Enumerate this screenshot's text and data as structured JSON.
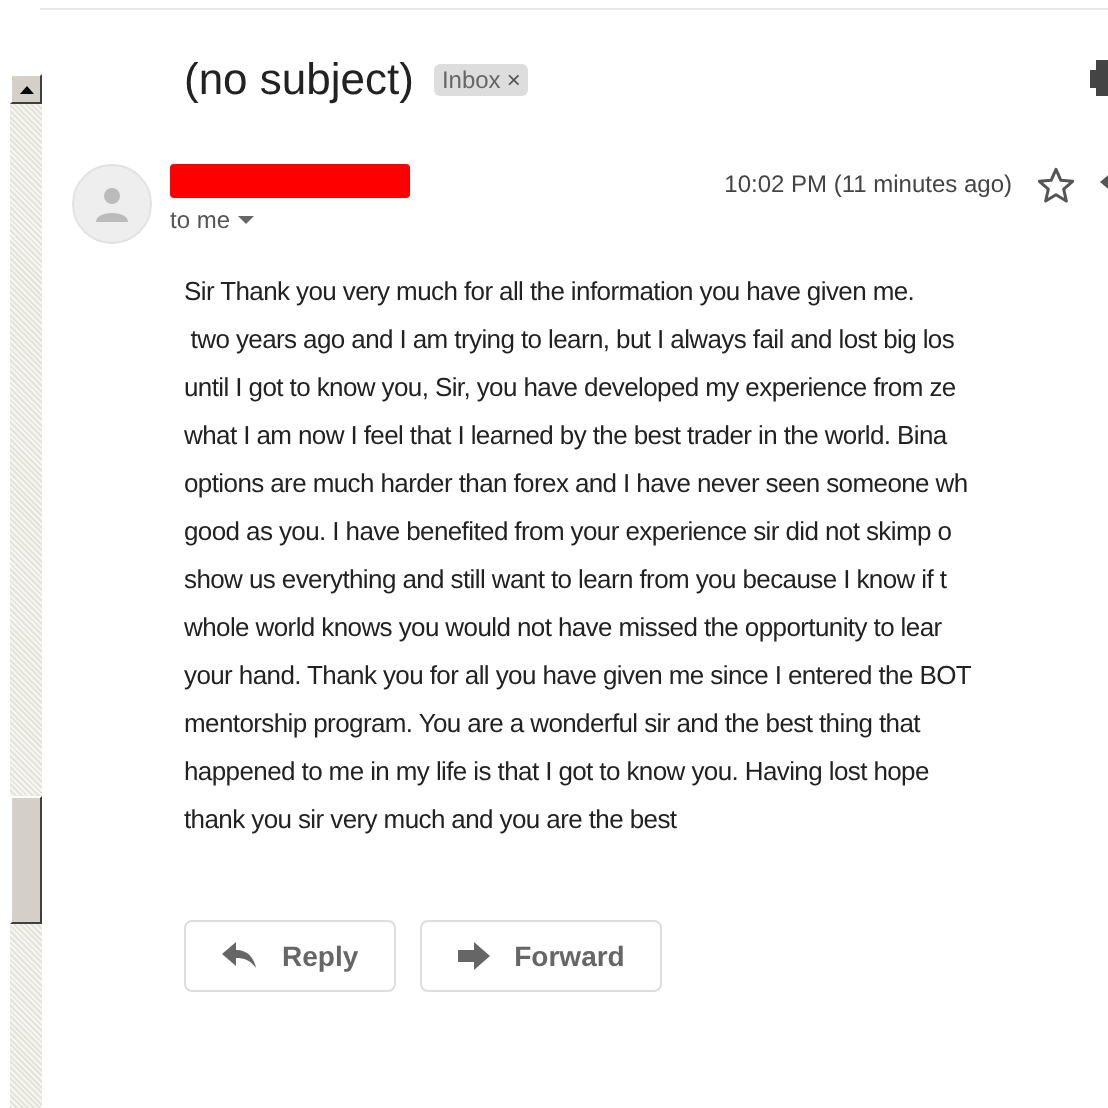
{
  "subject": "(no subject)",
  "label": {
    "text": "Inbox",
    "close": "×"
  },
  "message": {
    "recipient": "to me",
    "time": "10:02 PM (11 minutes ago)",
    "starred": false,
    "body": [
      "Sir Thank you very much for all the information you have given me.",
      " two years ago and I am trying to learn, but I always fail and lost big los",
      "until I got to know you, Sir, you have developed my experience from ze",
      "what I am now I feel that I learned by the best trader in the world. Bina",
      "options are much harder than forex and I have never seen someone wh",
      "good as you. I have benefited from your experience sir did not skimp o",
      "show us everything and still want to learn from you because I know if t",
      "whole world knows you would not have missed the opportunity to lear",
      "your hand. Thank you for all you have given me since I entered the BOT",
      "mentorship program. You are a wonderful sir and the best thing that",
      "happened to me in my life is that I got to know you. Having lost hope",
      "thank you sir very much and you are the best"
    ]
  },
  "actions": [
    {
      "kind": "reply",
      "label": "Reply"
    },
    {
      "kind": "forward",
      "label": "Forward"
    }
  ]
}
